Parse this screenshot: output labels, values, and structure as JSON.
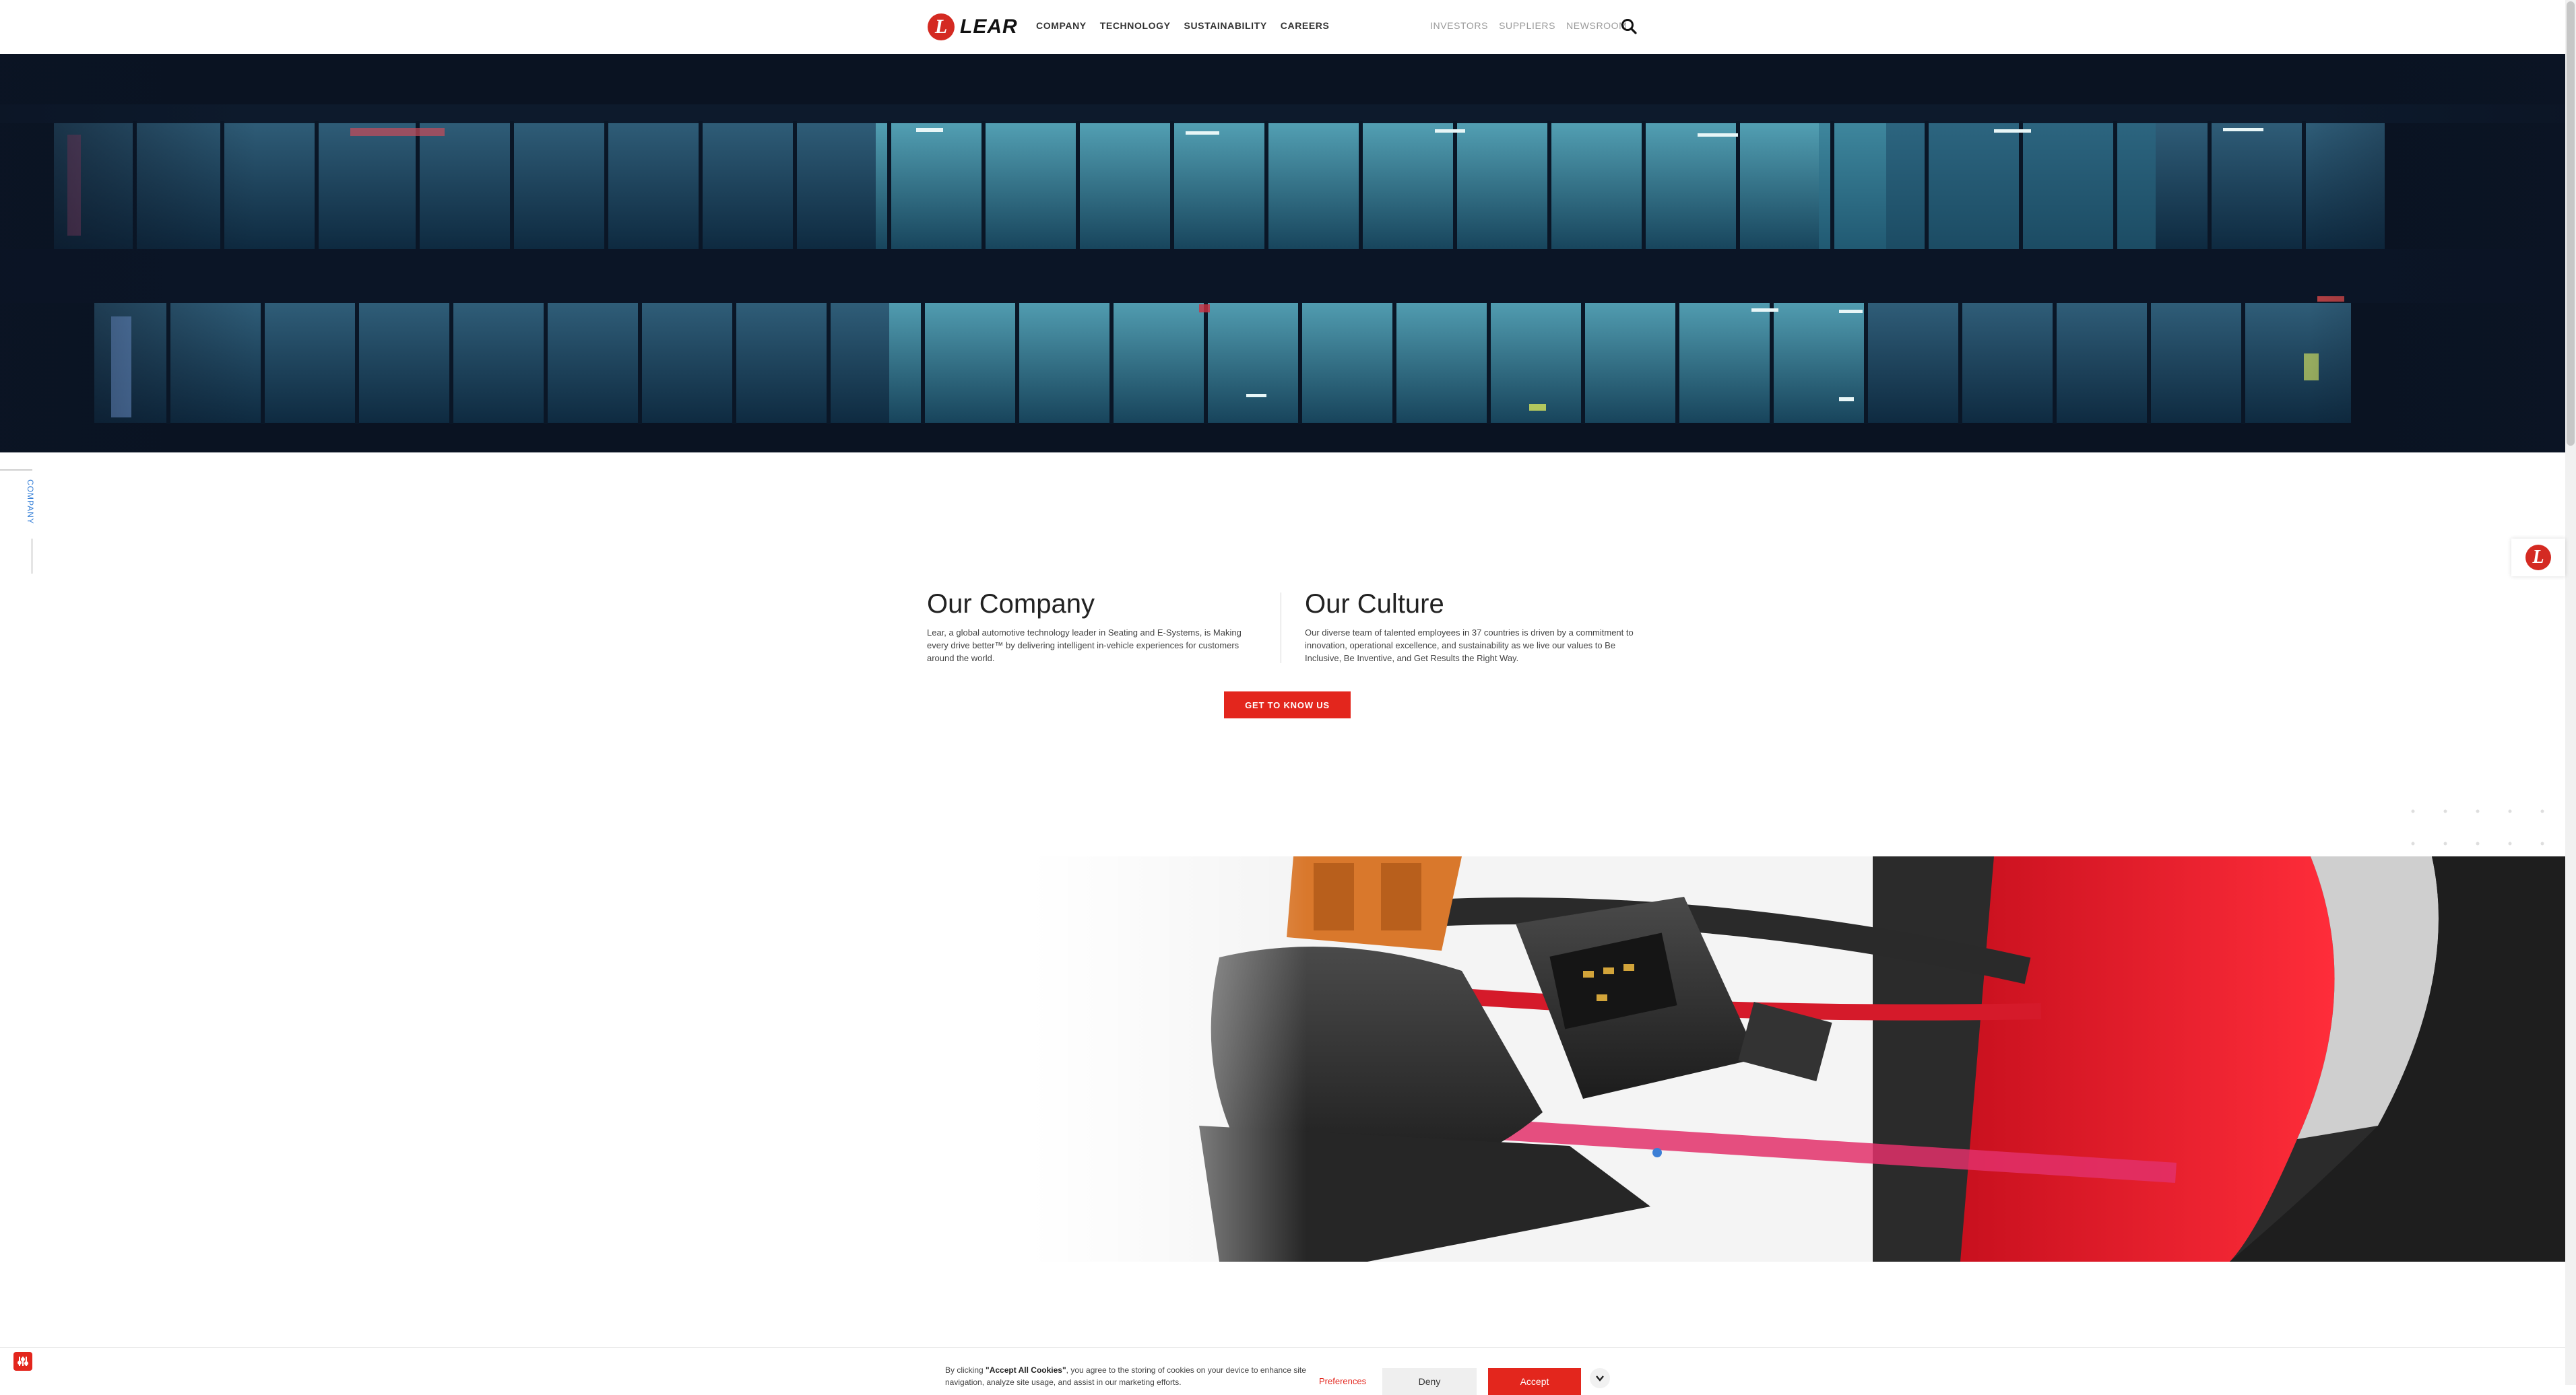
{
  "brand": {
    "name": "LEAR",
    "mark": "L",
    "accent": "#e3261d"
  },
  "nav": {
    "main": [
      "COMPANY",
      "TECHNOLOGY",
      "SUSTAINABILITY",
      "CAREERS"
    ],
    "utility": [
      "INVESTORS",
      "SUPPLIERS",
      "NEWSROOM"
    ],
    "search_icon": "search-icon"
  },
  "side_nav": {
    "label": "COMPANY"
  },
  "intro": {
    "company": {
      "title": "Our Company",
      "body": "Lear, a global automotive technology leader in Seating and E-Systems, is Making every drive better™ by delivering intelligent in-vehicle experiences for customers around the world."
    },
    "culture": {
      "title": "Our Culture",
      "body": "Our diverse team of talented employees in 37 countries is driven by a commitment to innovation, operational excellence, and sustainability as we live our values to Be Inclusive, Be Inventive, and Get Results the Right Way."
    },
    "cta": "GET TO KNOW US"
  },
  "cookie": {
    "text_prefix": "By clicking ",
    "text_bold": "\"Accept All Cookies\"",
    "text_suffix": ", you agree to the storing of cookies on your device to enhance site navigation, analyze site usage, and assist in our marketing efforts.",
    "preferences": "Preferences",
    "deny": "Deny",
    "accept": "Accept",
    "close_icon": "chevron-down-icon"
  }
}
